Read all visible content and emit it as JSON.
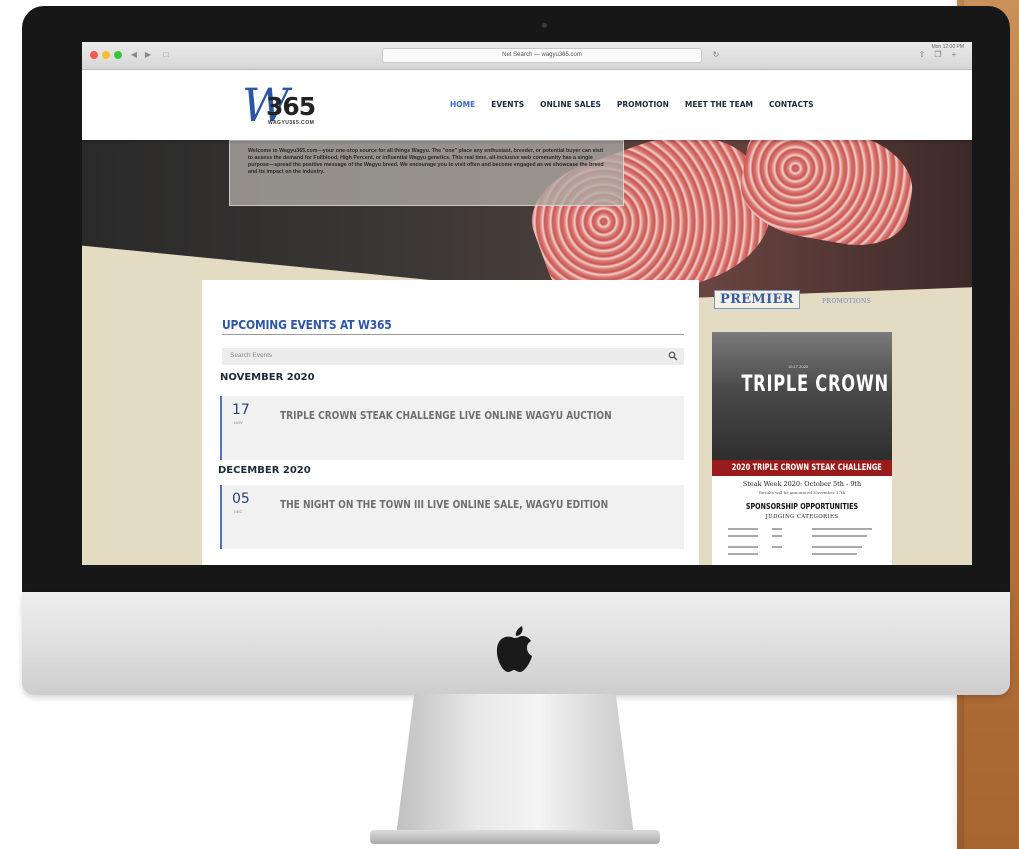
{
  "browser": {
    "url": "Net Search — wagyu365.com",
    "status_text": "Mon 12:00 PM"
  },
  "site": {
    "logo_letter": "W",
    "logo_number": "365",
    "logo_sub": "WAGYU365.COM",
    "nav": [
      {
        "label": "HOME",
        "active": true
      },
      {
        "label": "EVENTS",
        "active": false
      },
      {
        "label": "ONLINE SALES",
        "active": false
      },
      {
        "label": "PROMOTION",
        "active": false
      },
      {
        "label": "MEET THE TEAM",
        "active": false
      },
      {
        "label": "CONTACTS",
        "active": false
      }
    ],
    "hero_text": "Welcome to Wagyu365.com—your one-stop source for all things Wagyu. The \"one\" place any enthusiast, breeder, or potential buyer can visit to assess the demand for Fullblood, High Percent, or influential Wagyu genetics. This real time, all-inclusive web community has a single purpose—spread the positive message of the Wagyu breed. We encourage you to visit often and become engaged as we showcase the breed and its impact on the industry."
  },
  "events": {
    "title": "UPCOMING EVENTS AT W365",
    "search_placeholder": "Search Events",
    "groups": [
      {
        "month": "NOVEMBER 2020",
        "day": "17",
        "mon": "NOV",
        "title": "TRIPLE CROWN STEAK CHALLENGE LIVE ONLINE WAGYU AUCTION"
      },
      {
        "month": "DECEMBER 2020",
        "day": "05",
        "mon": "DEC",
        "title": "THE NIGHT ON THE TOWN III LIVE ONLINE SALE, WAGYU EDITION"
      }
    ]
  },
  "sidebar": {
    "premier": "PREMIER",
    "promotions": "PROMOTIONS",
    "poster": {
      "date": "10.17.2020",
      "title": "TRIPLE CROWN",
      "band": "2020 TRIPLE CROWN STEAK CHALLENGE",
      "sub": "Steak Week 2020: October 5th - 9th",
      "note": "Results will be announced November 17th",
      "sponsorship": "SPONSORSHIP OPPORTUNITIES",
      "judging": "JUDGING CATEGORIES"
    }
  },
  "colors": {
    "accent": "#2f55a5",
    "nav_active": "#3a6ec9",
    "band_red": "#9a1b1b",
    "page_bg": "#e4dcc2"
  }
}
